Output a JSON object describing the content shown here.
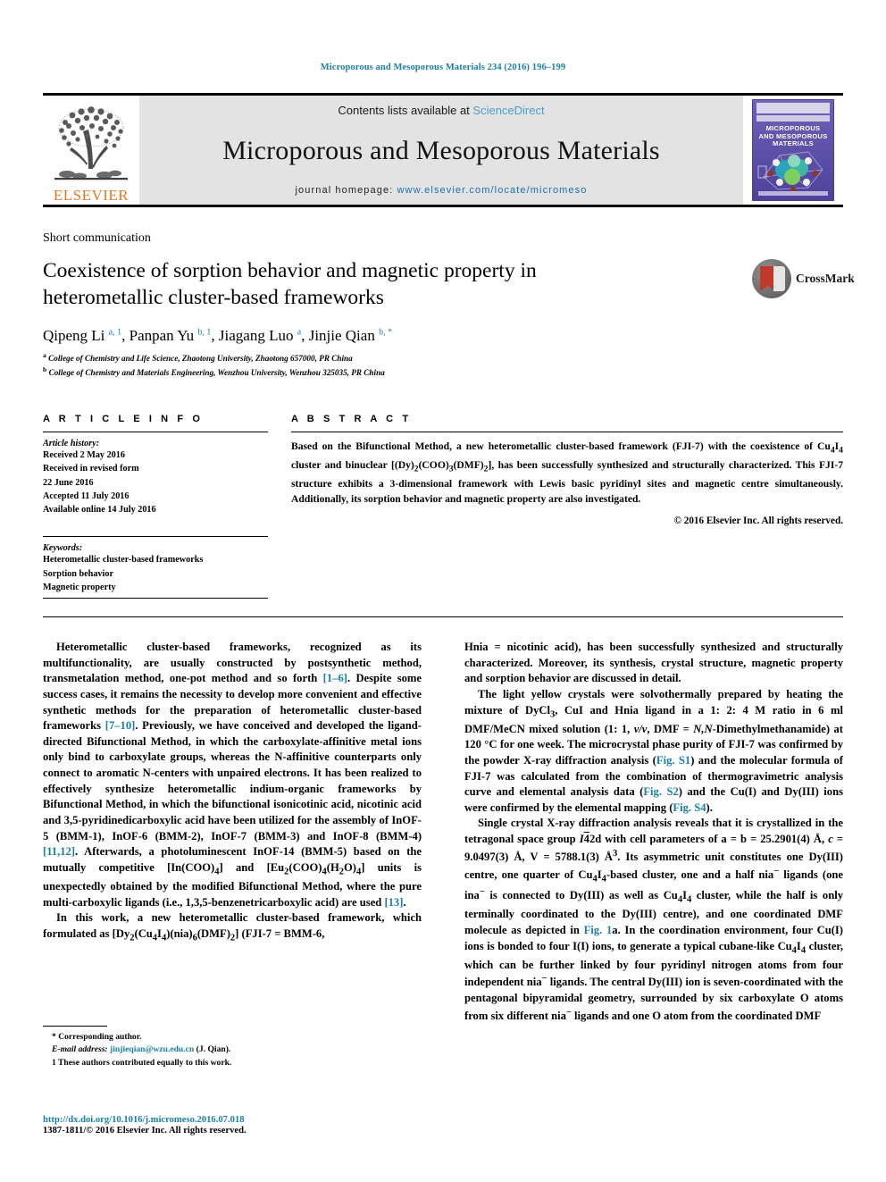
{
  "running_head": "Microporous and Mesoporous Materials 234 (2016) 196–199",
  "masthead": {
    "contents_prefix": "Contents lists available at ",
    "sciencedirect": "ScienceDirect",
    "journal_name": "Microporous and Mesoporous Materials",
    "homepage_prefix": "journal homepage: ",
    "homepage_url": "www.elsevier.com/locate/micromeso",
    "publisher_logo_text": "ELSEVIER",
    "cover_title": "MICROPOROUS AND MESOPOROUS MATERIALS",
    "accent_link_color": "#1a6fb5",
    "sciencedirect_color": "#4a9fd0",
    "elsevier_orange": "#E87722"
  },
  "article": {
    "type": "Short communication",
    "title": "Coexistence of sorption behavior and magnetic property in heterometallic cluster-based frameworks",
    "crossmark_label": "CrossMark",
    "authors_html": "Qipeng Li <sup>a, 1</sup>, Panpan Yu <sup>b, 1</sup>, Jiagang Luo <sup>a</sup>, Jinjie Qian <sup>b, *</sup>",
    "affiliations": [
      "a College of Chemistry and Life Science, Zhaotong University, Zhaotong 657000, PR China",
      "b College of Chemistry and Materials Engineering, Wenzhou University, Wenzhou 325035, PR China"
    ]
  },
  "article_info": {
    "heading": "A R T I C L E   I N F O",
    "history_label": "Article history:",
    "history": [
      "Received 2 May 2016",
      "Received in revised form",
      "22 June 2016",
      "Accepted 11 July 2016",
      "Available online 14 July 2016"
    ],
    "keywords_label": "Keywords:",
    "keywords": [
      "Heterometallic cluster-based frameworks",
      "Sorption behavior",
      "Magnetic property"
    ]
  },
  "abstract": {
    "heading": "A B S T R A C T",
    "text": "Based on the Bifunctional Method, a new heterometallic cluster-based framework (FJI-7) with the coexistence of Cu4I4 cluster and binuclear [(Dy)2(COO)3(DMF)2], has been successfully synthesized and structurally characterized. This FJI-7 structure exhibits a 3-dimensional framework with Lewis basic pyridinyl sites and magnetic centre simultaneously. Additionally, its sorption behavior and magnetic property are also investigated.",
    "copyright": "© 2016 Elsevier Inc. All rights reserved."
  },
  "body": {
    "left_paragraphs": [
      "Heterometallic cluster-based frameworks, recognized as its multifunctionality, are usually constructed by postsynthetic method, transmetalation method, one-pot method and so forth [1–6]. Despite some success cases, it remains the necessity to develop more convenient and effective synthetic methods for the preparation of heterometallic cluster-based frameworks [7–10]. Previously, we have conceived and developed the ligand-directed Bifunctional Method, in which the carboxylate-affinitive metal ions only bind to carboxylate groups, whereas the N-affinitive counterparts only connect to aromatic N-centers with unpaired electrons. It has been realized to effectively synthesize heterometallic indium-organic frameworks by Bifunctional Method, in which the bifunctional isonicotinic acid, nicotinic acid and 3,5-pyridinedicarboxylic acid have been utilized for the assembly of InOF-5 (BMM-1), InOF-6 (BMM-2), InOF-7 (BMM-3) and InOF-8 (BMM-4) [11,12]. Afterwards, a photoluminescent InOF-14 (BMM-5) based on the mutually competitive [In(COO)4] and [Eu2(COO)4(H2O)4] units is unexpectedly obtained by the modified Bifunctional Method, where the pure multi-carboxylic ligands (i.e., 1,3,5-benzenetricarboxylic acid) are used [13].",
      "In this work, a new heterometallic cluster-based framework, which formulated as [Dy2(Cu4I4)(nia)6(DMF)2] (FJI-7 = BMM-6,"
    ],
    "right_paragraphs": [
      "Hnia = nicotinic acid), has been successfully synthesized and structurally characterized. Moreover, its synthesis, crystal structure, magnetic property and sorption behavior are discussed in detail.",
      "The light yellow crystals were solvothermally prepared by heating the mixture of DyCl3, CuI and Hnia ligand in a 1: 2: 4 M ratio in 6 ml DMF/MeCN mixed solution (1: 1, v/v, DMF = N,N-Dimethylmethanamide) at 120 °C for one week. The microcrystal phase purity of FJI-7 was confirmed by the powder X-ray diffraction analysis (Fig. S1) and the molecular formula of FJI-7 was calculated from the combination of thermogravimetric analysis curve and elemental analysis data (Fig. S2) and the Cu(I) and Dy(III) ions were confirmed by the elemental mapping (Fig. S4).",
      "Single crystal X-ray diffraction analysis reveals that it is crystallized in the tetragonal space group I42d with cell parameters of a = b = 25.2901(4) Å, c = 9.0497(3) Å, V = 5788.1(3) Å3. Its asymmetric unit constitutes one Dy(III) centre, one quarter of Cu4I4-based cluster, one and a half nia− ligands (one ina− is connected to Dy(III) as well as Cu4I4 cluster, while the half is only terminally coordinated to the Dy(III) centre), and one coordinated DMF molecule as depicted in Fig. 1a. In the coordination environment, four Cu(I) ions is bonded to four I(I) ions, to generate a typical cubane-like Cu4I4 cluster, which can be further linked by four pyridinyl nitrogen atoms from four independent nia− ligands. The central Dy(III) ion is seven-coordinated with the pentagonal bipyramidal geometry, surrounded by six carboxylate O atoms from six different nia− ligands and one O atom from the coordinated DMF"
    ]
  },
  "footnotes": {
    "corresponding": "* Corresponding author.",
    "email_label": "E-mail address:",
    "email": "jinjieqian@wzu.edu.cn",
    "email_suffix": "(J. Qian).",
    "equal_contrib": "1  These authors contributed equally to this work."
  },
  "footer": {
    "doi": "http://dx.doi.org/10.1016/j.micromeso.2016.07.018",
    "issn_line": "1387-1811/© 2016 Elsevier Inc. All rights reserved."
  }
}
